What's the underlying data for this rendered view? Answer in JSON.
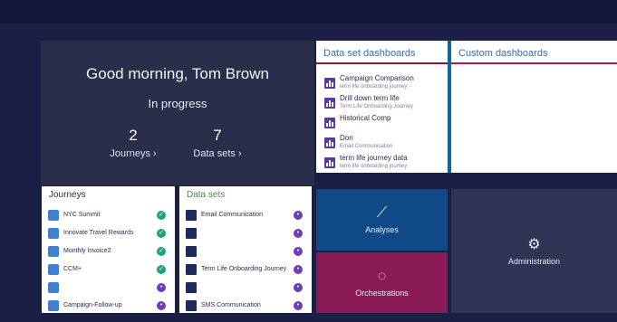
{
  "hero": {
    "greeting": "Good morning, Tom Brown",
    "status": "In progress",
    "metrics": [
      {
        "value": "2",
        "label": "Journeys"
      },
      {
        "value": "7",
        "label": "Data sets"
      }
    ]
  },
  "dashboards": {
    "data_set_title": "Data set dashboards",
    "custom_title": "Custom dashboards",
    "items": [
      {
        "name": "Campaign Comparison",
        "sub": "term life onboarding journey"
      },
      {
        "name": "Drill down term life",
        "sub": "Term Life Onboarding Journey"
      },
      {
        "name": "Historical Comp",
        "sub": ""
      },
      {
        "name": "Don",
        "sub": "Email Communication"
      },
      {
        "name": "term life journey data",
        "sub": "term life onboarding journey"
      }
    ]
  },
  "journeys": {
    "title": "Journeys",
    "items": [
      "NYC Summit",
      "Innovate Travel Rewards",
      "Monthly Invoice2",
      "CCM+",
      "",
      "Campaign-Follow-up"
    ]
  },
  "datasets": {
    "title": "Data sets",
    "items": [
      "Email Communication",
      "",
      "",
      "Term Life Onboarding Journey",
      "",
      "SMS Communication"
    ]
  },
  "tiles": {
    "analyses": "Analyses",
    "orchestrations": "Orchestrations",
    "administration": "Administration"
  },
  "colors": {
    "background": "#1b1f45",
    "hero": "#2b2e4a",
    "analyses": "#0f4a86",
    "orchestrations": "#8a1a55",
    "administration": "#2f3555",
    "accent_purple": "#5b3aa0",
    "status_green": "#1fa37a"
  },
  "icons": {
    "chart": "bar-chart-icon",
    "journey": "journey-icon",
    "dataset": "book-icon",
    "analyses": "analytics-icon",
    "orchestrations": "orchestration-icon",
    "admin": "gear-icon"
  }
}
